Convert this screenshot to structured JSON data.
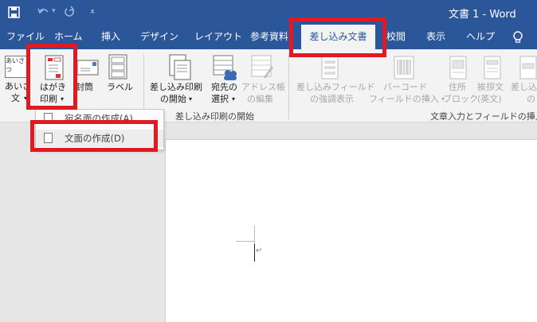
{
  "title_bar": {
    "document_title": "文書 1  -  Word",
    "save_icon": "save-icon",
    "undo_icon": "undo-icon",
    "redo_icon": "redo-icon",
    "customize_icon": "customize-icon"
  },
  "tabs": [
    {
      "label": "ファイル"
    },
    {
      "label": "ホーム"
    },
    {
      "label": "挿入"
    },
    {
      "label": "デザイン"
    },
    {
      "label": "レイアウト"
    },
    {
      "label": "参考資料"
    },
    {
      "label": "差し込み文書",
      "active": true
    },
    {
      "label": "校閲"
    },
    {
      "label": "表示"
    },
    {
      "label": "ヘルプ"
    }
  ],
  "ribbon": {
    "create": {
      "greeting_line1": "あいさ",
      "greeting_line2": "文",
      "hagaki_line1": "はがき",
      "hagaki_line2": "印刷",
      "envelope": "封筒",
      "label": "ラベル"
    },
    "start_group": {
      "start_merge_line1": "差し込み印刷",
      "start_merge_line2": "の開始",
      "recipients_line1": "宛先の",
      "recipients_line2": "選択",
      "edit_list_line1": "アドレス帳",
      "edit_list_line2": "の編集",
      "group_label": "差し込み印刷の開始"
    },
    "fields_group": {
      "highlight_line1": "差し込みフィールド",
      "highlight_line2": "の強調表示",
      "barcode_line1": "バーコード",
      "barcode_line2": "フィールドの挿入",
      "address_line1": "住所",
      "address_line2": "ブロック",
      "greeting_line1": "挨拶文",
      "greeting_line2": "(英文)",
      "insert_line1": "差し込",
      "insert_line2": "の",
      "group_label": "文章入力とフィールドの挿入"
    }
  },
  "dropdown": {
    "item1": "宛名面の作成(A)",
    "item2": "文面の作成(D)"
  },
  "colors": {
    "accent": "#2b579a",
    "highlight_box": "#e01a22",
    "ribbon_bg": "#f3f3f3"
  }
}
